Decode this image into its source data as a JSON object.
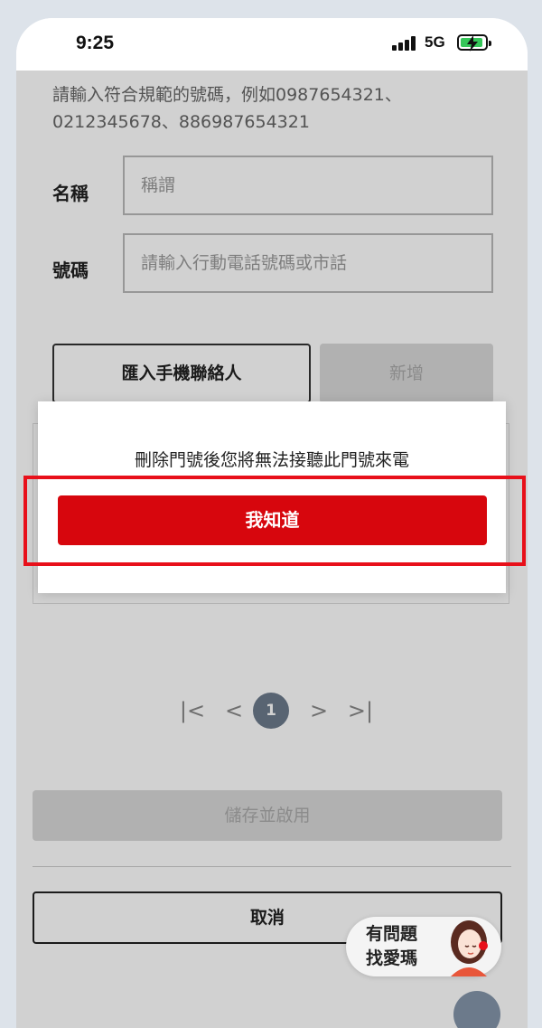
{
  "status_bar": {
    "time": "9:25",
    "network": "5G"
  },
  "form": {
    "hint": "請輸入符合規範的號碼，例如0987654321、0212345678、886987654321",
    "name_label": "名稱",
    "name_placeholder": "稱謂",
    "number_label": "號碼",
    "number_placeholder": "請輸入行動電話號碼或市話",
    "import_button": "匯入手機聯絡人",
    "add_button": "新增"
  },
  "pagination": {
    "first": "|<",
    "prev": "<",
    "current": "1",
    "next": ">",
    "last": ">|"
  },
  "actions": {
    "save_button": "儲存並啟用",
    "cancel_button": "取消"
  },
  "dialog": {
    "message": "刪除門號後您將無法接聽此門號來電",
    "ok_button": "我知道"
  },
  "help": {
    "line1": "有問題",
    "line2": "找愛瑪"
  },
  "colors": {
    "primary_red": "#d7060d",
    "highlight_red": "#e8101a",
    "pager_active": "#6c7a8b"
  }
}
